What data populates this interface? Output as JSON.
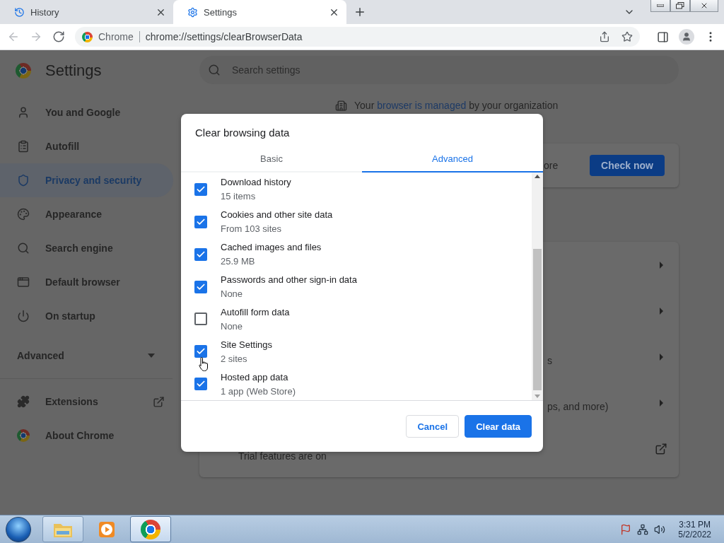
{
  "browser_tabs": [
    {
      "title": "History",
      "selected": false
    },
    {
      "title": "Settings",
      "selected": true
    }
  ],
  "toolbar": {
    "nav": [
      {
        "kind": "back",
        "disabled": true
      },
      {
        "kind": "forward",
        "disabled": true
      },
      {
        "kind": "reload",
        "disabled": false
      }
    ],
    "omnibox": {
      "label": "Chrome",
      "url": "chrome://settings/clearBrowserData"
    }
  },
  "settings": {
    "title": "Settings",
    "search": {
      "placeholder": "Search settings"
    },
    "sidebar": {
      "items": [
        {
          "label": "You and Google",
          "selected": false
        },
        {
          "label": "Autofill",
          "selected": false
        },
        {
          "label": "Privacy and security",
          "selected": true
        },
        {
          "label": "Appearance",
          "selected": false
        },
        {
          "label": "Search engine",
          "selected": false
        },
        {
          "label": "Default browser",
          "selected": false
        },
        {
          "label": "On startup",
          "selected": false
        }
      ],
      "advanced": {
        "label": "Advanced",
        "expanded": false
      },
      "more_items": [
        {
          "label": "Extensions",
          "external": true
        },
        {
          "label": "About Chrome",
          "external": false
        }
      ]
    },
    "managed_notice": {
      "before": "Your ",
      "link": "browser is managed",
      "after": " by your organization"
    },
    "safety_check": {
      "fragment": "ore",
      "button": "Check now"
    },
    "card_rows": [
      {
        "kind": "arrow"
      },
      {
        "kind": "arrow"
      },
      {
        "kind": "arrow",
        "fragment": "s"
      },
      {
        "kind": "arrow",
        "fragment": "ps, and more)"
      },
      {
        "kind": "external",
        "text": "Trial features are on"
      }
    ]
  },
  "dialog": {
    "title": "Clear browsing data",
    "tabs": [
      {
        "label": "Basic",
        "selected": false
      },
      {
        "label": "Advanced",
        "selected": true
      }
    ],
    "items": [
      {
        "title": "Download history",
        "detail": "15 items",
        "checked": true
      },
      {
        "title": "Cookies and other site data",
        "detail": "From 103 sites",
        "checked": true
      },
      {
        "title": "Cached images and files",
        "detail": "25.9 MB",
        "checked": true
      },
      {
        "title": "Passwords and other sign-in data",
        "detail": "None",
        "checked": true
      },
      {
        "title": "Autofill form data",
        "detail": "None",
        "checked": false
      },
      {
        "title": "Site Settings",
        "detail": "2 sites",
        "checked": true
      },
      {
        "title": "Hosted app data",
        "detail": "1 app (Web Store)",
        "checked": true
      }
    ],
    "buttons": [
      {
        "label": "Cancel",
        "kind": "secondary"
      },
      {
        "label": "Clear data",
        "kind": "primary"
      }
    ]
  },
  "taskbar": {
    "apps": [
      {
        "running": true,
        "selected": false
      },
      {
        "running": false,
        "selected": false
      },
      {
        "running": true,
        "selected": true
      }
    ],
    "clock": {
      "time": "3:31 PM",
      "date": "5/2/2022"
    }
  }
}
